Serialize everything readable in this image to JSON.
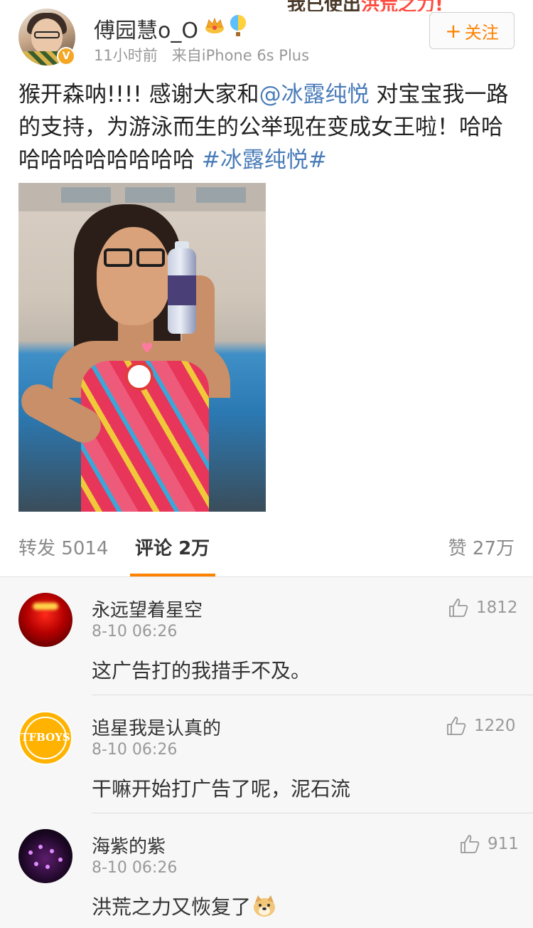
{
  "post": {
    "username": "傅园慧o_O",
    "time": "11小时前",
    "source": "来自iPhone 6s Plus",
    "follow_label": "关注",
    "follow_plus": "+",
    "verified_mark": "V",
    "banner_text_1": "我已使出",
    "banner_text_2": "洪荒之力!",
    "text_part1": "猴开森呐!!!! 感谢大家和",
    "mention": "@冰露纯悦",
    "text_part2": " 对宝宝我一路的支持，为游泳而生的公举现在变成女王啦！哈哈哈哈哈哈哈哈哈哈 ",
    "hashtag": "#冰露纯悦#"
  },
  "tabs": {
    "repost_label": "转发",
    "repost_count": "5014",
    "comment_label": "评论",
    "comment_count": "2万",
    "like_label": "赞",
    "like_count": "27万"
  },
  "comments": [
    {
      "name": "永远望着星空",
      "time": "8-10 06:26",
      "body": "这广告打的我措手不及。",
      "likes": "1812"
    },
    {
      "name": "追星我是认真的",
      "time": "8-10 06:26",
      "body": "干嘛开始打广告了呢，泥石流",
      "likes": "1220",
      "avatar_text": "TFBOYS"
    },
    {
      "name": "海紫的紫",
      "time": "8-10 06:26",
      "body": "洪荒之力又恢复了",
      "likes": "911"
    }
  ],
  "colors": {
    "accent": "#ff8200",
    "link": "#4a7cb8",
    "muted": "#999999"
  },
  "icons": [
    "crown-icon",
    "balloon-icon",
    "verified-icon",
    "thumbs-up-icon",
    "doge-emoji-icon"
  ]
}
